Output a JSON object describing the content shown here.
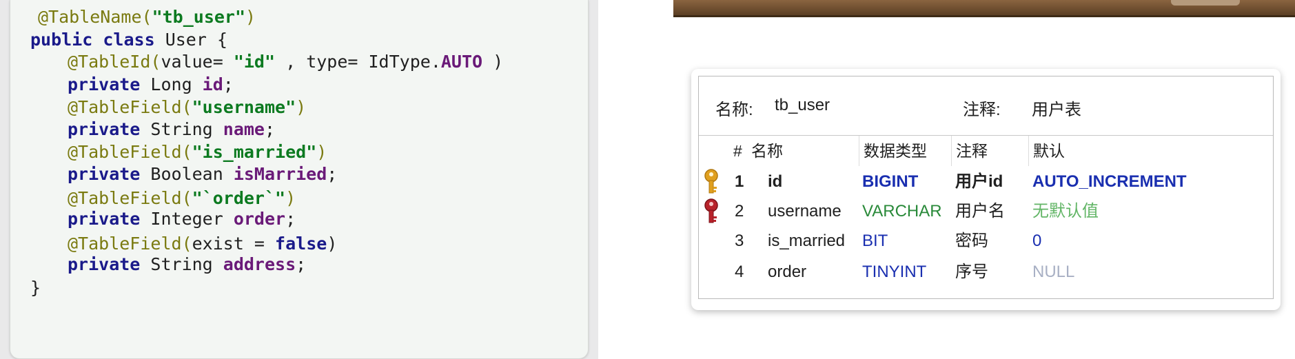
{
  "code": {
    "lines": [
      {
        "ann": "@TableName(",
        "str": "\"tb_user\"",
        "tail": ")"
      },
      {
        "kw1": "public",
        "kw2": "class",
        "rest": " User {"
      },
      {
        "ann": "@TableId(",
        "mid1": "value= ",
        "str": "\"id\"",
        "mid2": " , type= IdType.",
        "enm": "AUTO",
        "tail": " )"
      },
      {
        "kw": "private",
        "typ": " Long ",
        "fld": "id",
        "tail": ";"
      },
      {
        "ann": "@TableField(",
        "str": "\"username\"",
        "tail": ")"
      },
      {
        "kw": "private",
        "typ": " String ",
        "fld": "name",
        "tail": ";"
      },
      {
        "ann": "@TableField(",
        "str": "\"is_married\"",
        "tail": ")"
      },
      {
        "kw": "private",
        "typ": " Boolean ",
        "fld": "isMarried",
        "tail": ";"
      },
      {
        "ann": "@TableField(",
        "str": "\"`order`\"",
        "tail": ")"
      },
      {
        "kw": "private",
        "typ": " Integer ",
        "fld": "order",
        "tail": ";"
      },
      {
        "ann": "@TableField(",
        "mid1": "exist = ",
        "kw": "false",
        "tail": ")"
      },
      {
        "kw": "private",
        "typ": " String ",
        "fld": "address",
        "tail": ";"
      },
      {
        "rest": "}"
      }
    ]
  },
  "table": {
    "name_label": "名称:",
    "name_value": "tb_user",
    "comment_label": "注释:",
    "comment_value": "用户表",
    "columns": [
      "#",
      "名称",
      "数据类型",
      "注释",
      "默认"
    ],
    "rows": [
      {
        "idx": "1",
        "name": "id",
        "type": "BIGINT",
        "comment": "用户id",
        "default": "AUTO_INCREMENT",
        "icon": "primary-key-icon"
      },
      {
        "idx": "2",
        "name": "username",
        "type": "VARCHAR",
        "comment": "用户名",
        "default": "无默认值",
        "icon": "unique-key-icon"
      },
      {
        "idx": "3",
        "name": "is_married",
        "type": "BIT",
        "comment": "密码",
        "default": "0"
      },
      {
        "idx": "4",
        "name": "order",
        "type": "TINYINT",
        "comment": "序号",
        "default": "NULL"
      }
    ],
    "colors": {
      "blue": "#1a2fb0",
      "green": "#2a8a3a",
      "default_green": "#62b566",
      "null_gray": "#a8b0c4",
      "key_gold": "#e0a020",
      "key_red": "#b8232b"
    }
  }
}
